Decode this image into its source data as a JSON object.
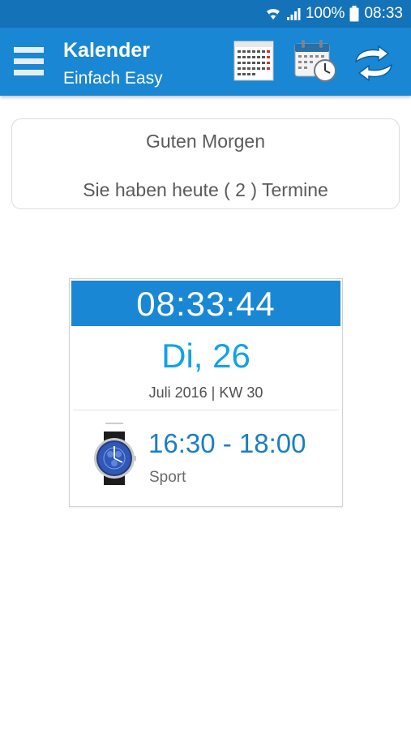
{
  "status_bar": {
    "battery": "100%",
    "time": "08:33",
    "icons": [
      "wifi-icon",
      "signal-icon",
      "battery-icon"
    ]
  },
  "app_bar": {
    "title": "Kalender",
    "subtitle": "Einfach Easy",
    "actions": [
      "month-calendar-icon",
      "calendar-clock-icon",
      "sync-icon"
    ]
  },
  "greeting": {
    "line1": "Guten Morgen",
    "line2": "Sie haben heute ( 2 ) Termine"
  },
  "clock": {
    "time": "08:33:44",
    "day": "Di, 26",
    "month_week": "Juli 2016 | KW 30"
  },
  "event": {
    "time_range": "16:30 - 18:00",
    "name": "Sport",
    "icon": "smartwatch-icon"
  },
  "colors": {
    "status_bar": "#1472b8",
    "app_bar": "#1a87d4",
    "day_text": "#12a2e6",
    "event_time": "#1a7ec2"
  }
}
